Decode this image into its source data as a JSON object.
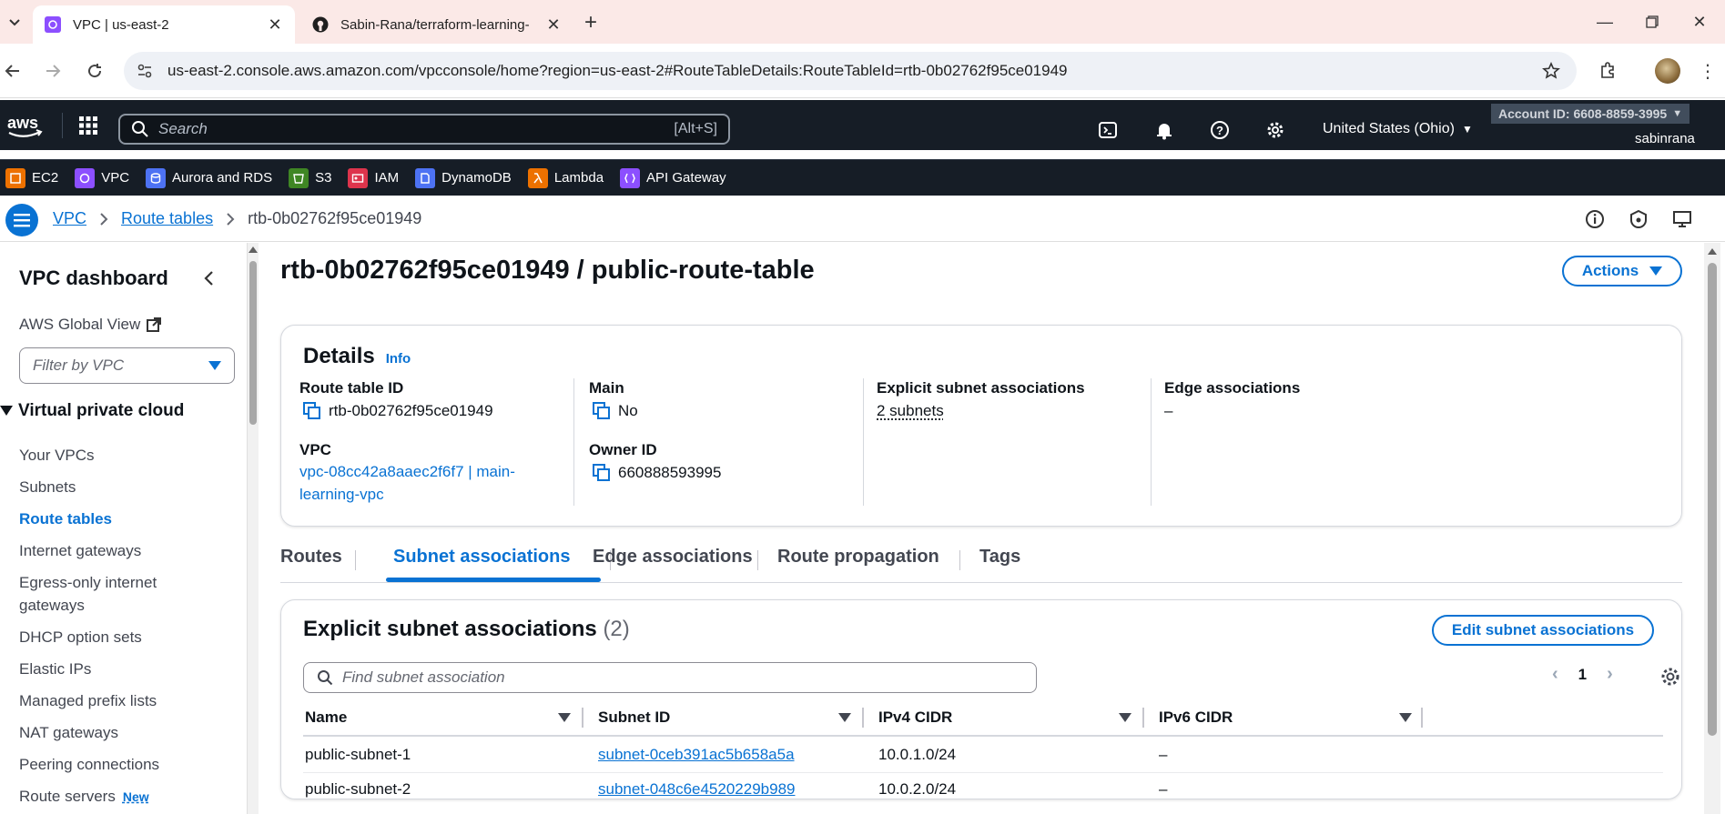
{
  "browser": {
    "tabs": [
      {
        "title": "VPC | us-east-2"
      },
      {
        "title": "Sabin-Rana/terraform-learning-"
      }
    ],
    "url": "us-east-2.console.aws.amazon.com/vpcconsole/home?region=us-east-2#RouteTableDetails:RouteTableId=rtb-0b02762f95ce01949"
  },
  "aws_nav": {
    "logo": "aws",
    "search_placeholder": "Search",
    "search_shortcut": "[Alt+S]",
    "region": "United States (Ohio)",
    "account": "Account ID: 6608-8859-3995",
    "username": "sabinrana"
  },
  "favorites": [
    {
      "label": "EC2",
      "color": "#ed7100"
    },
    {
      "label": "VPC",
      "color": "#8c4fff"
    },
    {
      "label": "Aurora and RDS",
      "color": "#4d72f3"
    },
    {
      "label": "S3",
      "color": "#3f8624"
    },
    {
      "label": "IAM",
      "color": "#dd344c"
    },
    {
      "label": "DynamoDB",
      "color": "#4d72f3"
    },
    {
      "label": "Lambda",
      "color": "#ed7100"
    },
    {
      "label": "API Gateway",
      "color": "#8c4fff"
    }
  ],
  "breadcrumb": {
    "items": [
      "VPC",
      "Route tables"
    ],
    "current": "rtb-0b02762f95ce01949"
  },
  "sidebar": {
    "title": "VPC dashboard",
    "global_view": "AWS Global View",
    "filter_placeholder": "Filter by VPC",
    "section": "Virtual private cloud",
    "items": [
      {
        "label": "Your VPCs"
      },
      {
        "label": "Subnets"
      },
      {
        "label": "Route tables"
      },
      {
        "label": "Internet gateways"
      },
      {
        "label": "Egress-only internet gateways"
      },
      {
        "label": "DHCP option sets"
      },
      {
        "label": "Elastic IPs"
      },
      {
        "label": "Managed prefix lists"
      },
      {
        "label": "NAT gateways"
      },
      {
        "label": "Peering connections"
      },
      {
        "label": "Route servers"
      }
    ],
    "new_badge": "New"
  },
  "page": {
    "title": "rtb-0b02762f95ce01949 / public-route-table",
    "actions_label": "Actions"
  },
  "details": {
    "heading": "Details",
    "info": "Info",
    "route_table_id_label": "Route table ID",
    "route_table_id": "rtb-0b02762f95ce01949",
    "vpc_label": "VPC",
    "vpc_value": "vpc-08cc42a8aaec2f6f7 | main-learning-vpc",
    "main_label": "Main",
    "main_value": "No",
    "owner_label": "Owner ID",
    "owner_value": "660888593995",
    "explicit_label": "Explicit subnet associations",
    "explicit_value": "2 subnets",
    "edge_label": "Edge associations",
    "edge_value": "–"
  },
  "tabs": [
    "Routes",
    "Subnet associations",
    "Edge associations",
    "Route propagation",
    "Tags"
  ],
  "associations": {
    "heading": "Explicit subnet associations",
    "count": "(2)",
    "edit_label": "Edit subnet associations",
    "find_placeholder": "Find subnet association",
    "page": "1",
    "columns": [
      "Name",
      "Subnet ID",
      "IPv4 CIDR",
      "IPv6 CIDR"
    ],
    "rows": [
      {
        "name": "public-subnet-1",
        "subnet_id": "subnet-0ceb391ac5b658a5a",
        "ipv4": "10.0.1.0/24",
        "ipv6": "–"
      },
      {
        "name": "public-subnet-2",
        "subnet_id": "subnet-048c6e4520229b989",
        "ipv4": "10.0.2.0/24",
        "ipv6": "–"
      }
    ]
  }
}
